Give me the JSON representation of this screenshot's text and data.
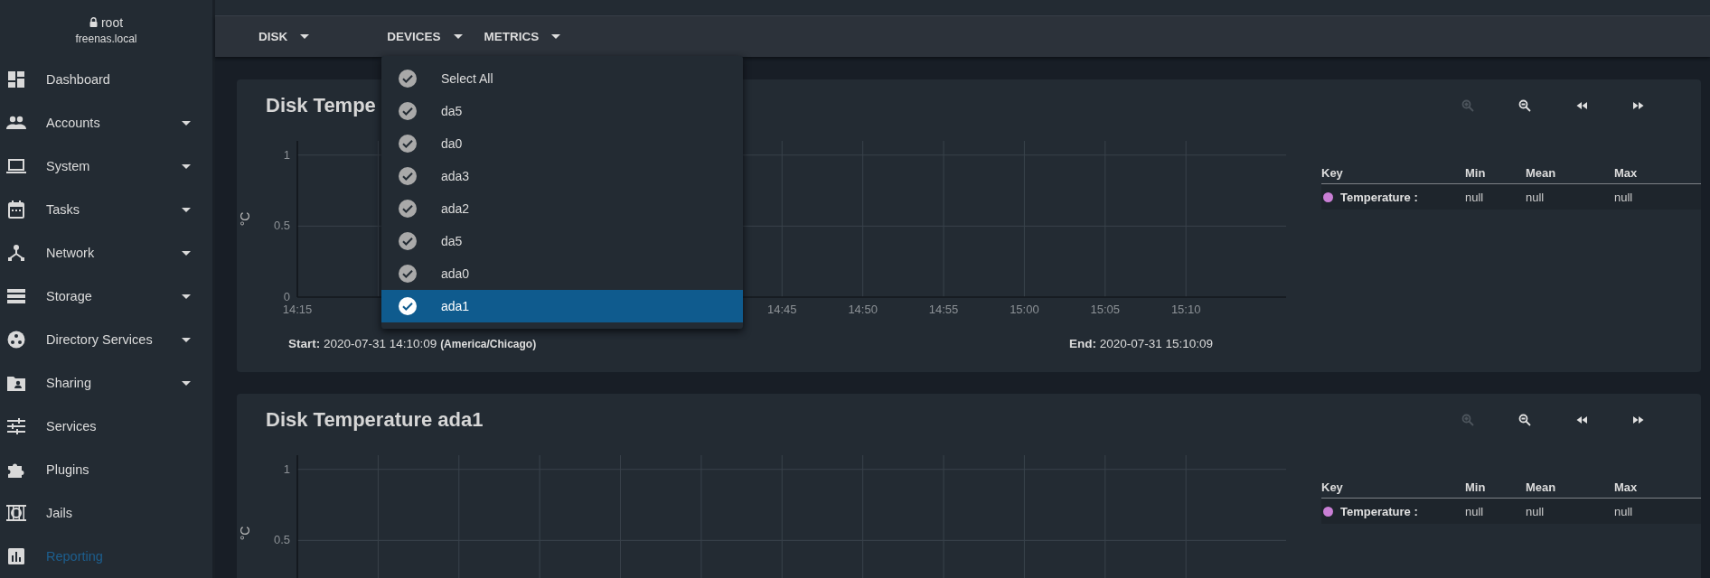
{
  "user": {
    "name": "root",
    "host": "freenas.local"
  },
  "sidebar": {
    "items": [
      {
        "label": "Dashboard",
        "expandable": false,
        "selected": false
      },
      {
        "label": "Accounts",
        "expandable": true,
        "selected": false
      },
      {
        "label": "System",
        "expandable": true,
        "selected": false
      },
      {
        "label": "Tasks",
        "expandable": true,
        "selected": false
      },
      {
        "label": "Network",
        "expandable": true,
        "selected": false
      },
      {
        "label": "Storage",
        "expandable": true,
        "selected": false
      },
      {
        "label": "Directory Services",
        "expandable": true,
        "selected": false
      },
      {
        "label": "Sharing",
        "expandable": true,
        "selected": false
      },
      {
        "label": "Services",
        "expandable": false,
        "selected": false
      },
      {
        "label": "Plugins",
        "expandable": false,
        "selected": false
      },
      {
        "label": "Jails",
        "expandable": false,
        "selected": false
      },
      {
        "label": "Reporting",
        "expandable": false,
        "selected": true
      }
    ]
  },
  "toolbar": {
    "menus": [
      {
        "label": "DISK"
      },
      {
        "label": "DEVICES"
      },
      {
        "label": "METRICS"
      }
    ]
  },
  "device_menu": {
    "options": [
      {
        "label": "Select All",
        "checked": true,
        "selected": false
      },
      {
        "label": "da5",
        "checked": true,
        "selected": false
      },
      {
        "label": "da0",
        "checked": true,
        "selected": false
      },
      {
        "label": "ada3",
        "checked": true,
        "selected": false
      },
      {
        "label": "ada2",
        "checked": true,
        "selected": false
      },
      {
        "label": "da5",
        "checked": true,
        "selected": false
      },
      {
        "label": "ada0",
        "checked": true,
        "selected": false
      },
      {
        "label": "ada1",
        "checked": true,
        "selected": true
      }
    ]
  },
  "charts": [
    {
      "title": "Disk Tempe",
      "controls": [
        {
          "kind": "zoom_in",
          "disabled": true
        },
        {
          "kind": "zoom_out",
          "disabled": false
        },
        {
          "kind": "back",
          "disabled": false
        },
        {
          "kind": "forward",
          "disabled": false
        }
      ],
      "chart_data": {
        "type": "line",
        "ylabel": "°C",
        "grid": true,
        "ylim": [
          0,
          1.1
        ],
        "yticks": [
          0,
          0.5,
          1
        ],
        "categories": [
          "14:15",
          null,
          null,
          null,
          null,
          null,
          "14:45",
          "14:50",
          "14:55",
          "15:00",
          "15:05",
          "15:10"
        ]
      },
      "start": {
        "label": "Start:",
        "value": "2020-07-31 14:10:09",
        "zone": "(America/Chicago)"
      },
      "end": {
        "label": "End:",
        "value": "2020-07-31 15:10:09"
      },
      "legend": {
        "columns": [
          "Key",
          "Min",
          "Mean",
          "Max"
        ],
        "rows": [
          {
            "name": "Temperature :",
            "color": "#c97fd5",
            "min": "null",
            "mean": "null",
            "max": "null"
          }
        ]
      }
    },
    {
      "title": "Disk Temperature ada1",
      "controls": [
        {
          "kind": "zoom_in",
          "disabled": true
        },
        {
          "kind": "zoom_out",
          "disabled": false
        },
        {
          "kind": "back",
          "disabled": false
        },
        {
          "kind": "forward",
          "disabled": false
        }
      ],
      "chart_data": {
        "type": "line",
        "ylabel": "°C",
        "grid": true,
        "ylim": [
          0,
          1.1
        ],
        "yticks": [
          0.5,
          1
        ],
        "categories": [
          null,
          null,
          null,
          null,
          null,
          null,
          null,
          null,
          null,
          null,
          null,
          null
        ]
      },
      "legend": {
        "columns": [
          "Key",
          "Min",
          "Mean",
          "Max"
        ],
        "rows": [
          {
            "name": "Temperature :",
            "color": "#c97fd5",
            "min": "null",
            "mean": "null",
            "max": "null"
          }
        ]
      }
    }
  ]
}
